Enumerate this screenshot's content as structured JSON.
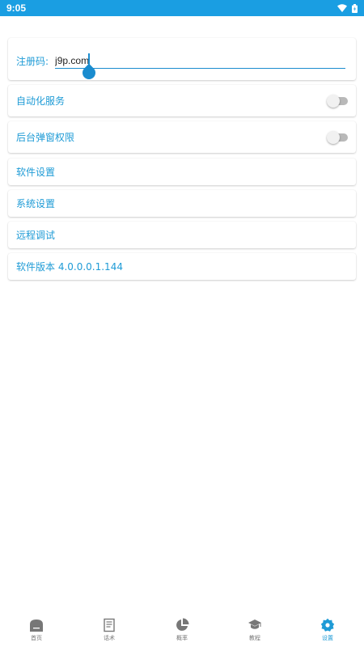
{
  "status_bar": {
    "time": "9:05"
  },
  "registration": {
    "label": "注册码:",
    "value": "j9p.com"
  },
  "settings": {
    "automation_service": {
      "label": "自动化服务",
      "enabled": false
    },
    "background_popup_permission": {
      "label": "后台弹窗权限",
      "enabled": false
    },
    "software_settings": {
      "label": "软件设置"
    },
    "system_settings": {
      "label": "系统设置"
    },
    "remote_debug": {
      "label": "远程调试"
    },
    "software_version": {
      "label": "软件版本 4.0.0.0.1.144"
    }
  },
  "bottom_nav": [
    {
      "label": "首页",
      "icon": "home-icon",
      "active": false
    },
    {
      "label": "话术",
      "icon": "document-icon",
      "active": false
    },
    {
      "label": "概率",
      "icon": "pie-chart-icon",
      "active": false
    },
    {
      "label": "教程",
      "icon": "graduation-cap-icon",
      "active": false
    },
    {
      "label": "设置",
      "icon": "gear-icon",
      "active": true
    }
  ],
  "colors": {
    "status_bar": "#1a9ee2",
    "accent": "#1e9bd6",
    "inactive_nav": "#777777"
  }
}
